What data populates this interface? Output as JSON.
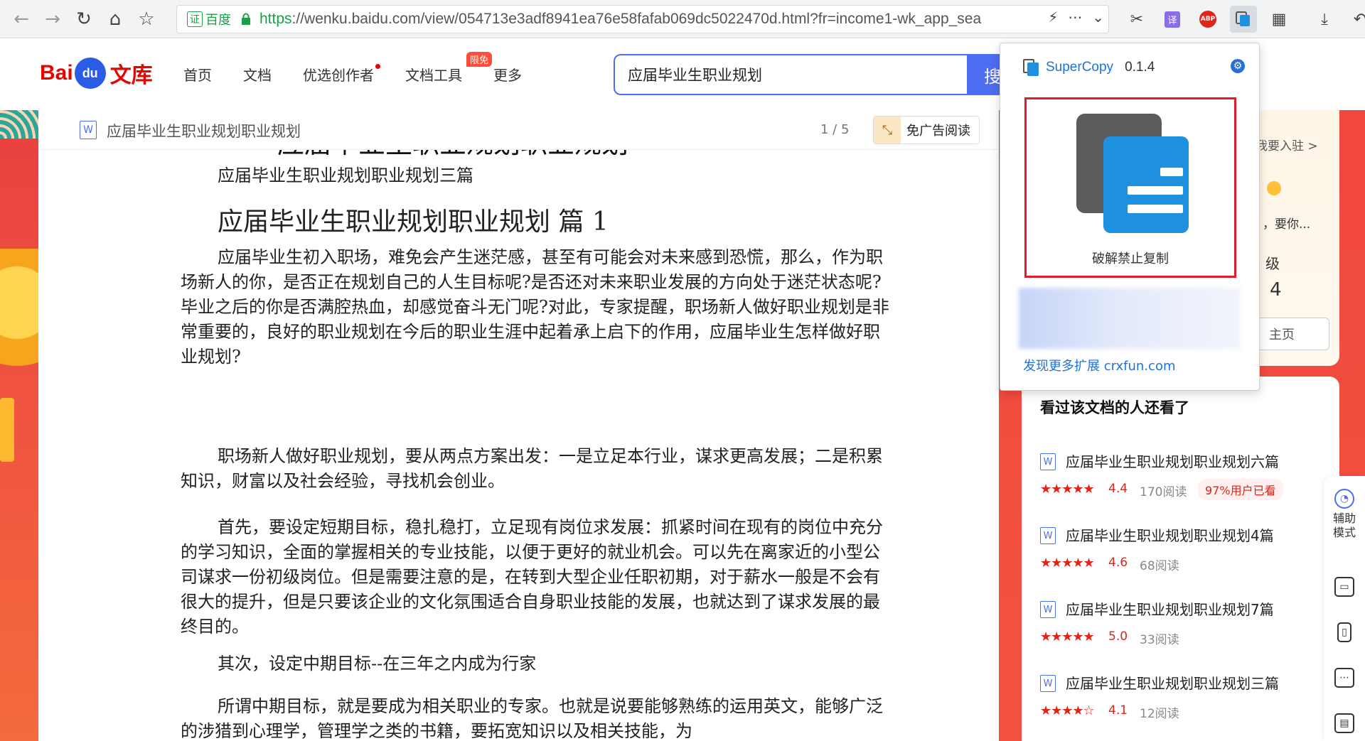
{
  "browser": {
    "cert_label": "证",
    "cert_text": "百度",
    "url_scheme": "https",
    "url_rest": "://wenku.baidu.com/view/054713e3adf8941ea76e58fafab069dc5022470d.html?fr=income1-wk_app_sea"
  },
  "header": {
    "logo_bai": "Bai",
    "logo_du": "du",
    "logo_wenku": "文库",
    "nav": [
      "首页",
      "文档",
      "优选创作者",
      "文档工具",
      "更多"
    ],
    "badge": "限免",
    "search_value": "应届毕业生职业规划",
    "search_button": "搜"
  },
  "doc": {
    "title": "应届毕业生职业规划职业规划",
    "pager": "1 / 5",
    "no_ad": "免广告阅读",
    "cut_title": "应届毕业生职业规划职业规划",
    "subhead": "应届毕业生职业规划职业规划三篇",
    "heading": "应届毕业生职业规划职业规划  篇 1",
    "paragraphs": [
      "应届毕业生初入职场，难免会产生迷茫感，甚至有可能会对未来感到恐慌，那么，作为职场新人的你，是否正在规划自己的人生目标呢?是否还对未来职业发展的方向处于迷茫状态呢?毕业之后的你是否满腔热血，却感觉奋斗无门呢?对此，专家提醒，职场新人做好职业规划是非常重要的，良好的职业规划在今后的职业生涯中起着承上启下的作用，应届毕业生怎样做好职业规划?",
      "职场新人做好职业规划，要从两点方案出发：一是立足本行业，谋求更高发展；二是积累知识，财富以及社会经验，寻找机会创业。",
      "首先，要设定短期目标，稳扎稳打，立足现有岗位求发展：抓紧时间在现有的岗位中充分的学习知识，全面的掌握相关的专业技能，以便于更好的就业机会。可以先在离家近的小型公司谋求一份初级岗位。但是需要注意的是，在转到大型企业任职初期，对于薪水一般是不会有很大的提升，但是只要该企业的文化氛围适合自身职业技能的发展，也就达到了谋求发展的最终目的。",
      "其次，设定中期目标--在三年之内成为行家",
      "所谓中期目标，就是要成为相关职业的专家。也就是说要能够熟练的运用英文，能够广泛的涉猎到心理学，管理学之类的书籍，要拓宽知识以及相关技能，为"
    ]
  },
  "right_panel": {
    "join": "我要入驻 >",
    "want": "，要你...",
    "level_label": "级",
    "level_value": "4",
    "home_btn": "主页",
    "list_title": "看过该文档的人还看了",
    "items": [
      {
        "name": "应届毕业生职业规划职业规划六篇",
        "stars": "★★★★★",
        "score": "4.4",
        "reads": "170阅读",
        "tag": "97%用户已看"
      },
      {
        "name": "应届毕业生职业规划职业规划4篇",
        "stars": "★★★★★",
        "score": "4.6",
        "reads": "68阅读",
        "tag": ""
      },
      {
        "name": "应届毕业生职业规划职业规划7篇",
        "stars": "★★★★★",
        "score": "5.0",
        "reads": "33阅读",
        "tag": ""
      },
      {
        "name": "应届毕业生职业规划职业规划三篇",
        "stars": "★★★★☆",
        "score": "4.1",
        "reads": "12阅读",
        "tag": ""
      }
    ],
    "tools": {
      "assist": "辅助模式"
    }
  },
  "popup": {
    "name": "SuperCopy",
    "version": "0.1.4",
    "action_label": "破解禁止复制",
    "more_link": "发现更多扩展 crxfun.com"
  },
  "colors": {
    "baidu_red": "#e10602",
    "baidu_blue": "#4e6ef2",
    "popup_blue": "#1f8fe0",
    "highlight_red": "#e31b2b"
  }
}
